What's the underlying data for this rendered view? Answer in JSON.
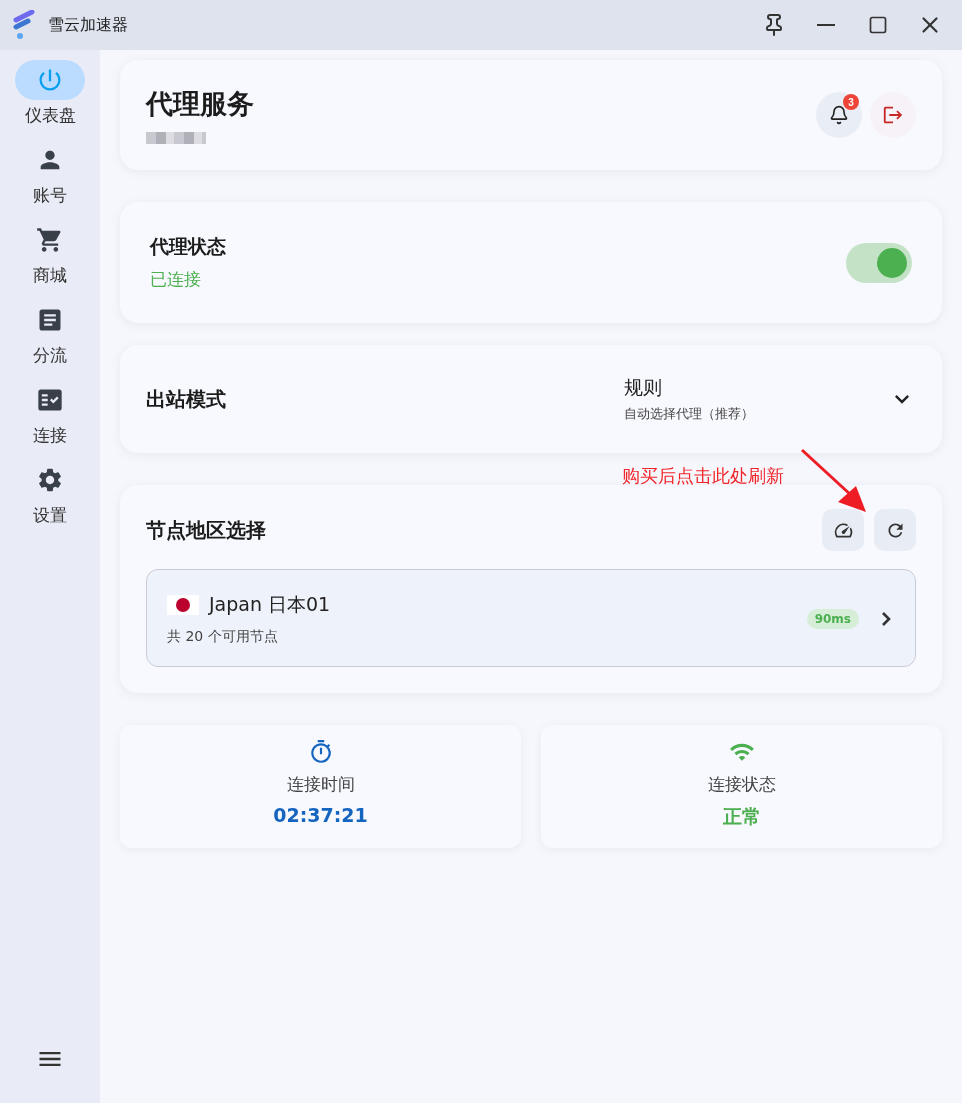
{
  "window": {
    "title": "雪云加速器"
  },
  "sidebar": {
    "items": [
      {
        "label": "仪表盘",
        "selected": true
      },
      {
        "label": "账号",
        "selected": false
      },
      {
        "label": "商城",
        "selected": false
      },
      {
        "label": "分流",
        "selected": false
      },
      {
        "label": "连接",
        "selected": false
      },
      {
        "label": "设置",
        "selected": false
      }
    ]
  },
  "header": {
    "title": "代理服务",
    "notification_count": "3"
  },
  "proxy_status": {
    "title": "代理状态",
    "status": "已连接",
    "on": true
  },
  "outbound_mode": {
    "title": "出站模式",
    "value": "规则",
    "description": "自动选择代理（推荐）"
  },
  "annotation": {
    "text": "购买后点击此处刷新"
  },
  "node_region": {
    "title": "节点地区选择",
    "node": {
      "name": "Japan 日本01",
      "count": "共 20 个可用节点",
      "latency": "90ms"
    }
  },
  "stats": [
    {
      "kind": "time",
      "label": "连接时间",
      "value": "02:37:21"
    },
    {
      "kind": "status",
      "label": "连接状态",
      "value": "正常"
    }
  ]
}
